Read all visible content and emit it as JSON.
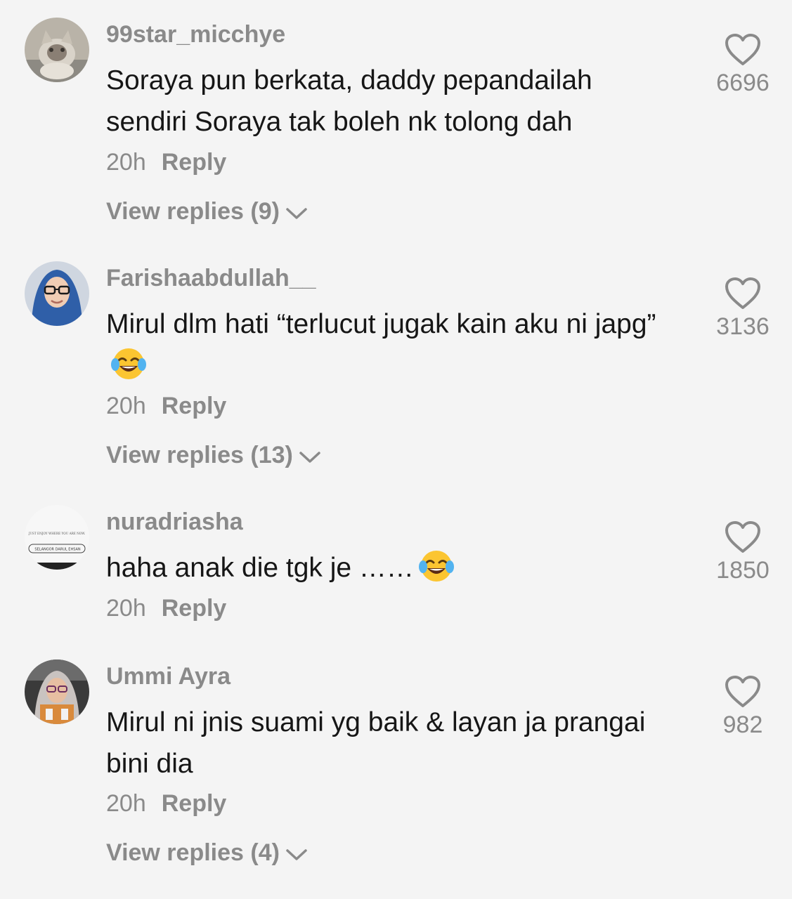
{
  "comments": [
    {
      "username": "99star_micchye",
      "text": "Soraya pun berkata, daddy pepandailah sendiri Soraya tak boleh nk tolong dah",
      "time": "20h",
      "reply_label": "Reply",
      "view_replies": "View replies (9)",
      "likes": "6696",
      "avatar": "cat-photo-avatar"
    },
    {
      "username": "Farishaabdullah__",
      "text": "Mirul dlm hati “terlucut jugak kain aku ni japg”",
      "time": "20h",
      "reply_label": "Reply",
      "view_replies": "View replies (13)",
      "likes": "3136",
      "avatar": "woman-hijab-glasses-avatar"
    },
    {
      "username": "nuradriasha",
      "text": "haha anak die tgk je ……",
      "time": "20h",
      "reply_label": "Reply",
      "likes": "1850",
      "avatar": "selangor-text-avatar",
      "avatar_lines": [
        "JUST ENJOY WHERE YOU ARE NOW.",
        "SELANGOR DARUL EHSAN"
      ]
    },
    {
      "username": "Ummi Ayra",
      "text": "Mirul ni jnis suami yg baik & layan ja prangai bini dia",
      "time": "20h",
      "reply_label": "Reply",
      "view_replies": "View replies (4)",
      "likes": "982",
      "avatar": "woman-hijab-car-avatar"
    }
  ],
  "icons": {
    "like": "heart-outline-icon",
    "expand": "chevron-down-icon",
    "emoji": "face-with-tears-of-joy-emoji"
  },
  "colors": {
    "background": "#f4f4f4",
    "text": "#161616",
    "muted": "#8a8a8a"
  }
}
